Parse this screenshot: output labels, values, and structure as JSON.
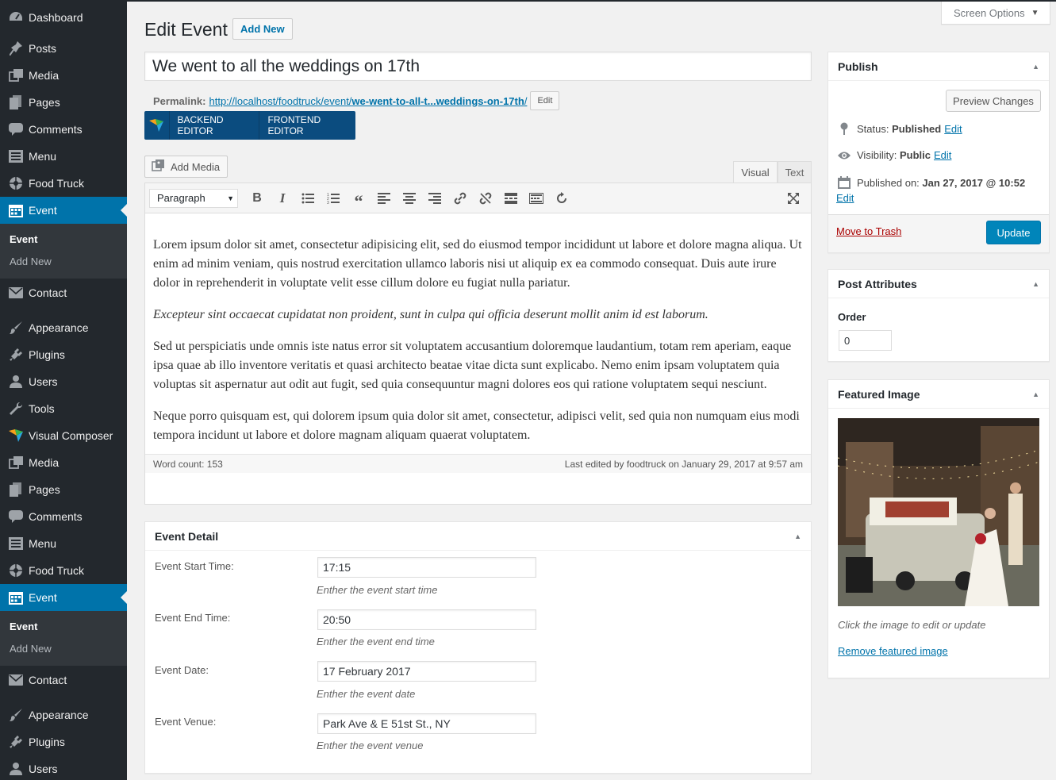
{
  "sidebar": {
    "group1": [
      {
        "icon": "dashboard-icon",
        "label": "Dashboard"
      },
      {
        "icon": "pin-icon",
        "label": "Posts"
      },
      {
        "icon": "media-icon",
        "label": "Media"
      },
      {
        "icon": "pages-icon",
        "label": "Pages"
      },
      {
        "icon": "comment-icon",
        "label": "Comments"
      },
      {
        "icon": "menu-icon",
        "label": "Menu"
      },
      {
        "icon": "food-truck-icon",
        "label": "Food Truck"
      },
      {
        "icon": "calendar-icon",
        "label": "Event"
      }
    ],
    "submenu": {
      "current": "Event",
      "add_new": "Add New"
    },
    "contact": "Contact",
    "group2": [
      {
        "icon": "appearance-icon",
        "label": "Appearance"
      },
      {
        "icon": "plugins-icon",
        "label": "Plugins"
      },
      {
        "icon": "users-icon",
        "label": "Users"
      },
      {
        "icon": "tools-icon",
        "label": "Tools"
      },
      {
        "icon": "visual-composer-icon",
        "label": "Visual Composer"
      },
      {
        "icon": "media-icon",
        "label": "Media"
      },
      {
        "icon": "pages-icon",
        "label": "Pages"
      },
      {
        "icon": "comment-icon",
        "label": "Comments"
      },
      {
        "icon": "menu-icon",
        "label": "Menu"
      },
      {
        "icon": "food-truck-icon",
        "label": "Food Truck"
      },
      {
        "icon": "calendar-icon",
        "label": "Event"
      }
    ],
    "group3": [
      {
        "icon": "appearance-icon",
        "label": "Appearance"
      },
      {
        "icon": "plugins-icon",
        "label": "Plugins"
      },
      {
        "icon": "users-icon",
        "label": "Users"
      }
    ]
  },
  "header": {
    "screen_options": "Screen Options",
    "title": "Edit Event",
    "add_new": "Add New"
  },
  "post": {
    "title": "We went to all the weddings on 17th",
    "permalink_label": "Permalink:",
    "permalink_base": "http://localhost/foodtruck/event/",
    "permalink_slug": "we-went-to-all-t...weddings-on-17th",
    "permalink_trailing": "/",
    "permalink_edit": "Edit"
  },
  "vc": {
    "backend": "BACKEND EDITOR",
    "frontend": "FRONTEND EDITOR"
  },
  "editor": {
    "add_media": "Add Media",
    "tab_visual": "Visual",
    "tab_text": "Text",
    "format": "Paragraph",
    "paragraphs": [
      "Lorem ipsum dolor sit amet, consectetur adipisicing elit, sed do eiusmod tempor incididunt ut labore et dolore magna aliqua. Ut enim ad minim veniam, quis nostrud exercitation ullamco laboris nisi ut aliquip ex ea commodo consequat. Duis aute irure dolor in reprehenderit in voluptate velit esse cillum dolore eu fugiat nulla pariatur.",
      "Excepteur sint occaecat cupidatat non proident, sunt in culpa qui officia deserunt mollit anim id est laborum.",
      "Sed ut perspiciatis unde omnis iste natus error sit voluptatem accusantium doloremque laudantium, totam rem aperiam, eaque ipsa quae ab illo inventore veritatis et quasi architecto beatae vitae dicta sunt explicabo. Nemo enim ipsam voluptatem quia voluptas sit aspernatur aut odit aut fugit, sed quia consequuntur magni dolores eos qui ratione voluptatem sequi nesciunt.",
      "Neque porro quisquam est, qui dolorem ipsum quia dolor sit amet, consectetur, adipisci velit, sed quia non numquam eius modi tempora incidunt ut labore et dolore magnam aliquam quaerat voluptatem."
    ],
    "word_count": "Word count: 153",
    "last_edited": "Last edited by foodtruck on January 29, 2017 at 9:57 am"
  },
  "event_detail": {
    "title": "Event Detail",
    "start_label": "Event Start Time:",
    "start_value": "17:15",
    "start_desc": "Enther the event start time",
    "end_label": "Event End Time:",
    "end_value": "20:50",
    "end_desc": "Enther the event end time",
    "date_label": "Event Date:",
    "date_value": "17 February 2017",
    "date_desc": "Enther the event date",
    "venue_label": "Event Venue:",
    "venue_value": "Park Ave & E 51st St., NY",
    "venue_desc": "Enther the event venue"
  },
  "publish": {
    "title": "Publish",
    "preview": "Preview Changes",
    "status_label": "Status:",
    "status_value": "Published",
    "status_edit": "Edit",
    "visibility_label": "Visibility:",
    "visibility_value": "Public",
    "visibility_edit": "Edit",
    "published_label": "Published on:",
    "published_value": "Jan 27, 2017 @ 10:52",
    "published_edit": "Edit",
    "trash": "Move to Trash",
    "update": "Update"
  },
  "attributes": {
    "title": "Post Attributes",
    "order_label": "Order",
    "order_value": "0"
  },
  "featured": {
    "title": "Featured Image",
    "hint": "Click the image to edit or update",
    "remove": "Remove featured image"
  }
}
